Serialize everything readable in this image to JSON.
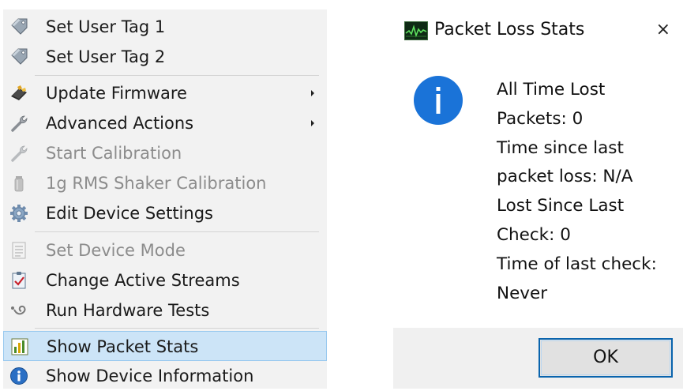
{
  "menu": {
    "items": [
      {
        "label": "Set User Tag 1",
        "icon": "tag-icon",
        "enabled": true
      },
      {
        "label": "Set User Tag 2",
        "icon": "tag-icon",
        "enabled": true
      },
      {
        "label": "Update Firmware",
        "icon": "chip-icon",
        "enabled": true,
        "submenu": true
      },
      {
        "label": "Advanced Actions",
        "icon": "wrench-icon",
        "enabled": true,
        "submenu": true
      },
      {
        "label": "Start Calibration",
        "icon": "wrench-icon",
        "enabled": false
      },
      {
        "label": "1g RMS Shaker Calibration",
        "icon": "cylinder-icon",
        "enabled": false
      },
      {
        "label": "Edit Device Settings",
        "icon": "gear-icon",
        "enabled": true
      },
      {
        "label": "Set Device Mode",
        "icon": "list-icon",
        "enabled": false
      },
      {
        "label": "Change Active Streams",
        "icon": "checklist-icon",
        "enabled": true
      },
      {
        "label": "Run Hardware Tests",
        "icon": "probe-icon",
        "enabled": true
      },
      {
        "label": "Show Packet Stats",
        "icon": "bar-chart-icon",
        "enabled": true,
        "highlighted": true
      },
      {
        "label": "Show Device Information",
        "icon": "info-icon",
        "enabled": true
      }
    ]
  },
  "dialog": {
    "title": "Packet Loss Stats",
    "close": "×",
    "icon": "info-icon",
    "message_lines": [
      "All Time Lost",
      "Packets: 0",
      "Time since last",
      "packet loss: N/A",
      "Lost Since Last",
      "Check: 0",
      "Time of last check:",
      "Never"
    ],
    "ok_label": "OK"
  },
  "colors": {
    "menu_bg": "#f2f2f2",
    "highlight_bg": "#cce4f7",
    "highlight_border": "#99c9ef",
    "disabled_text": "#8c8c8c",
    "info_blue": "#1a73d8",
    "button_border": "#0a64ad",
    "footer_bg": "#f0f0f0"
  }
}
